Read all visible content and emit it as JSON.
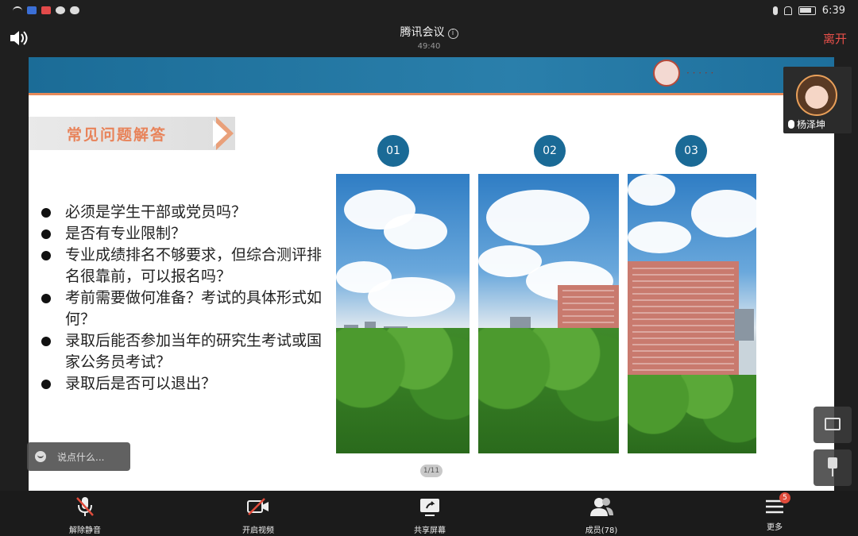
{
  "status_bar": {
    "time": "6:39"
  },
  "header": {
    "title": "腾讯会议",
    "timer": "49:40",
    "leave_label": "离开"
  },
  "slide": {
    "section_title": "常见问题解答",
    "numbers": [
      "01",
      "02",
      "03"
    ],
    "questions": [
      "必须是学生干部或党员吗？",
      "是否有专业限制？",
      "专业成绩排名不够要求，但综合测评排名很靠前，可以报名吗？",
      "考前需要做何准备？考试的具体形式如何？",
      "录取后能否参加当年的研究生考试或国家公务员考试？",
      "录取后是否可以退出？"
    ],
    "page_indicator": "1/11"
  },
  "chat": {
    "placeholder": "说点什么..."
  },
  "participant": {
    "name": "杨泽坤"
  },
  "toolbar": {
    "unmute_label": "解除静音",
    "video_label": "开启视频",
    "share_label": "共享屏幕",
    "members_label": "成员(78)",
    "more_label": "更多",
    "more_badge": "5"
  },
  "colors": {
    "accent_blue": "#1a6a96",
    "leave_red": "#e8504a",
    "faq_orange": "#e8835a"
  }
}
